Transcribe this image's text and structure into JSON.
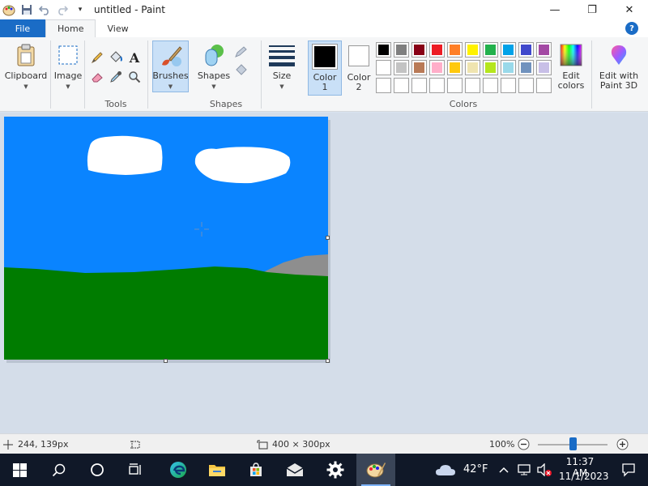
{
  "window": {
    "title": "untitled - Paint",
    "minimize_glyph": "—",
    "maximize_glyph": "❐",
    "close_glyph": "✕"
  },
  "tabs": [
    {
      "label": "File"
    },
    {
      "label": "Home"
    },
    {
      "label": "View"
    }
  ],
  "help_glyph": "?",
  "ribbon": {
    "clipboard_label": "Clipboard",
    "image_label": "Image",
    "tools_group_label": "Tools",
    "brushes_label": "Brushes",
    "shapes_label": "Shapes",
    "shapes_group_label": "Shapes",
    "size_label": "Size",
    "color1_line1": "Color",
    "color1_line2": "1",
    "color2_line1": "Color",
    "color2_line2": "2",
    "colors_group_label": "Colors",
    "edit_colors_line1": "Edit",
    "edit_colors_line2": "colors",
    "paint3d_line1": "Edit with",
    "paint3d_line2": "Paint 3D",
    "color1_value": "#000000",
    "color2_value": "#ffffff"
  },
  "palette": {
    "row1": [
      "#000000",
      "#7f7f7f",
      "#880015",
      "#ed1c24",
      "#ff7f27",
      "#fff200",
      "#22b14c",
      "#00a2e8",
      "#3f48cc",
      "#a349a4"
    ],
    "row2": [
      "#ffffff",
      "#c3c3c3",
      "#b97a57",
      "#ffaec9",
      "#ffc90e",
      "#efe4b0",
      "#b5e61d",
      "#99d9ea",
      "#7092be",
      "#c8bfe7"
    ],
    "row3": [
      "#ffffff",
      "#ffffff",
      "#ffffff",
      "#ffffff",
      "#ffffff",
      "#ffffff",
      "#ffffff",
      "#ffffff",
      "#ffffff",
      "#ffffff"
    ]
  },
  "canvas": {
    "sky_color": "#0a84ff",
    "ground_color": "#007c00",
    "mountain_color": "#8e8e8e",
    "cloud_color": "#ffffff"
  },
  "statusbar": {
    "cursor_position": "244, 139px",
    "canvas_size": "400 × 300px",
    "zoom": "100%"
  },
  "taskbar": {
    "weather": "42°F",
    "time": "11:37 AM",
    "date": "11/1/2023"
  }
}
